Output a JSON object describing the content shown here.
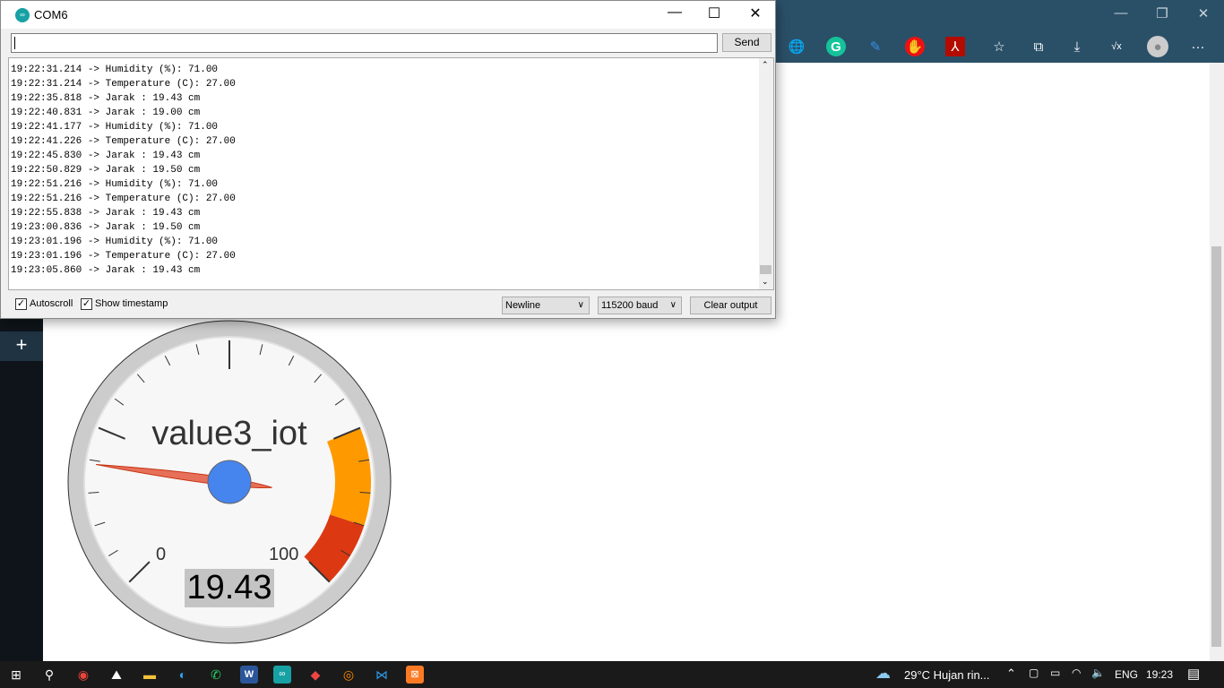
{
  "window": {
    "title": "COM6",
    "send_label": "Send",
    "input_value": ""
  },
  "serial_lines": [
    "19:22:31.214 -> Humidity (%): 71.00",
    "19:22:31.214 -> Temperature (C): 27.00",
    "19:22:35.818 -> Jarak : 19.43 cm",
    "19:22:40.831 -> Jarak : 19.00 cm",
    "19:22:41.177 -> Humidity (%): 71.00",
    "19:22:41.226 -> Temperature (C): 27.00",
    "19:22:45.830 -> Jarak : 19.43 cm",
    "19:22:50.829 -> Jarak : 19.50 cm",
    "19:22:51.216 -> Humidity (%): 71.00",
    "19:22:51.216 -> Temperature (C): 27.00",
    "19:22:55.838 -> Jarak : 19.43 cm",
    "19:23:00.836 -> Jarak : 19.50 cm",
    "19:23:01.196 -> Humidity (%): 71.00",
    "19:23:01.196 -> Temperature (C): 27.00",
    "19:23:05.860 -> Jarak : 19.43 cm"
  ],
  "bottom": {
    "autoscroll": "Autoscroll",
    "autoscroll_checked": true,
    "timestamp": "Show timestamp",
    "timestamp_checked": true,
    "line_ending": "Newline",
    "baud": "115200 baud",
    "clear": "Clear output"
  },
  "gauge": {
    "label": "value3_iot",
    "value": 19.43,
    "value_text": "19.43",
    "min": 0,
    "max": 100,
    "min_label": "0",
    "max_label": "100",
    "yellow_from": 75,
    "yellow_to": 90,
    "red_from": 90,
    "red_to": 100,
    "colors": {
      "yellow": "#ff9900",
      "red": "#dc3912",
      "needle": "#e7705a",
      "hub": "#4684ee"
    }
  },
  "taskbar": {
    "weather": "29°C  Hujan rin...",
    "lang": "ENG",
    "time": "19:23"
  }
}
